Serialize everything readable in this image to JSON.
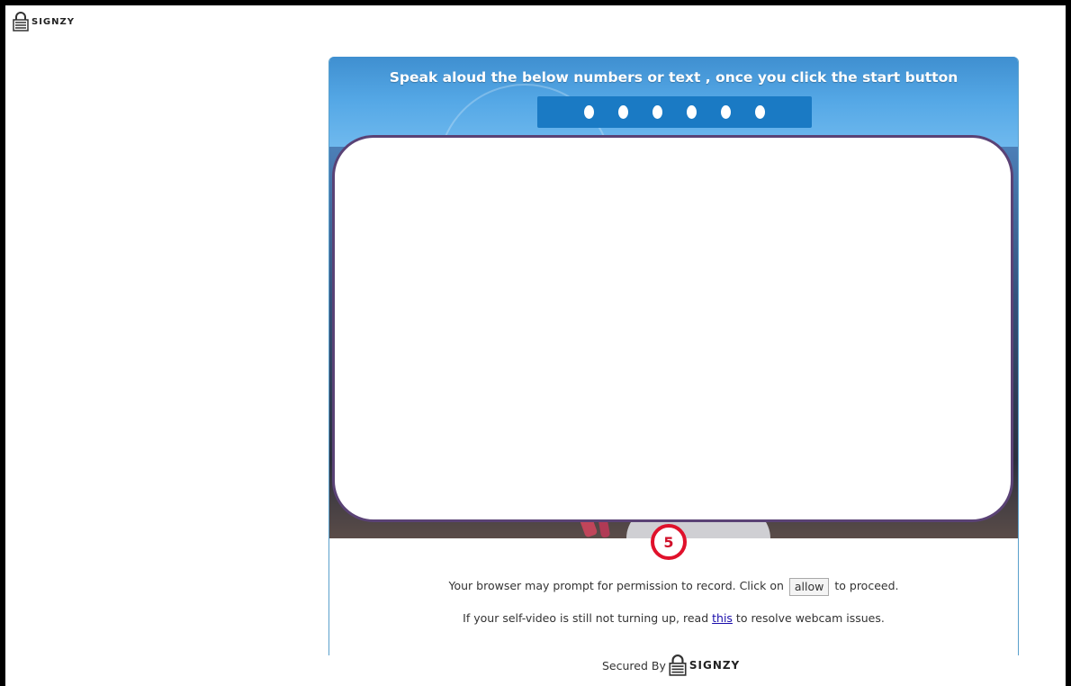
{
  "brand": {
    "name": "SIGNZY",
    "icon": "lock-icon"
  },
  "card": {
    "instruction": "Speak aloud the below numbers or text , once you click the start button",
    "code_placeholder_count": 6
  },
  "step": {
    "number": "5",
    "color": "#e0112b"
  },
  "permission": {
    "before": "Your browser may prompt for permission to record. Click on",
    "allow_label": "allow",
    "after": "to proceed."
  },
  "help": {
    "before": "If your self-video is still not turning up, read",
    "link_label": "this",
    "after": "to resolve webcam issues."
  },
  "footer": {
    "secured_label": "Secured By",
    "brand_name": "SIGNZY"
  },
  "colors": {
    "header_blue": "#55a8e6",
    "code_box": "#1a7ac4",
    "overlay_border": "#5a4275"
  }
}
